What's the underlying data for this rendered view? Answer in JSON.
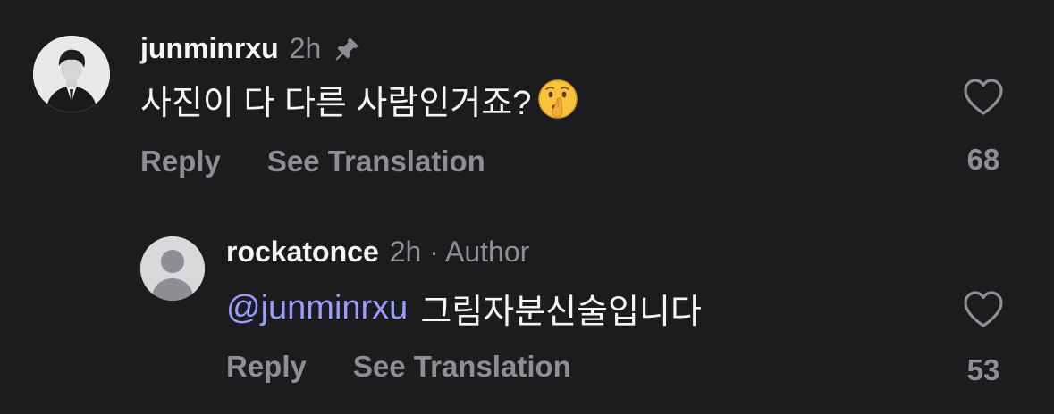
{
  "comments": [
    {
      "username": "junminrxu",
      "time": "2h",
      "text": "사진이 다 다른 사람인거죠?",
      "emoji_icon": "shushing-face-icon",
      "pin_icon": "pin-icon",
      "actions": {
        "reply": "Reply",
        "translate": "See Translation"
      },
      "likes": "68"
    },
    {
      "username": "rockatonce",
      "meta": "2h · Author",
      "mention": "@junminrxu",
      "text": "그림자분신술입니다",
      "actions": {
        "reply": "Reply",
        "translate": "See Translation"
      },
      "likes": "53"
    }
  ],
  "colors": {
    "background": "#1c1c1e",
    "text": "#f5f5f7",
    "muted": "#8e8e93",
    "mention": "#9a9cff"
  }
}
